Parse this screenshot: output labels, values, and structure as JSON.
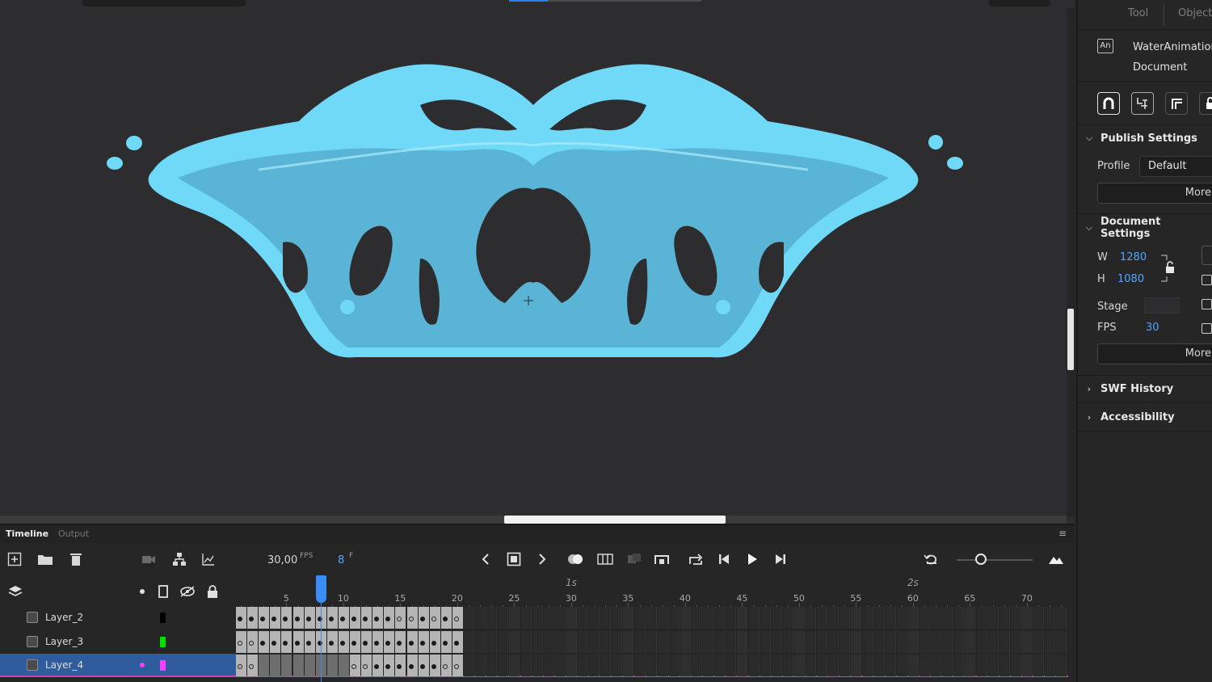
{
  "document": {
    "file_name": "WaterAnimation.f",
    "type_label": "Document"
  },
  "properties": {
    "tabs": [
      {
        "label": "Tool"
      },
      {
        "label": "Object"
      }
    ],
    "publish_settings": {
      "title": "Publish Settings",
      "profile_label": "Profile",
      "profile_value": "Default",
      "more_label": "More"
    },
    "document_settings": {
      "title": "Document Settings",
      "w_label": "W",
      "w_value": "1280",
      "h_label": "H",
      "h_value": "1080",
      "stage_label": "Stage",
      "fps_label": "FPS",
      "fps_value": "30",
      "more_label": "More"
    },
    "swf_history": {
      "title": "SWF History"
    },
    "accessibility": {
      "title": "Accessibility"
    }
  },
  "timeline": {
    "tabs": [
      {
        "label": "Timeline"
      },
      {
        "label": "Output"
      }
    ],
    "fps_value": "30,00",
    "fps_unit": "FPS",
    "frame_value": "8",
    "frame_unit": "F",
    "ruler_frames": [
      "5",
      "10",
      "15",
      "20",
      "25",
      "30",
      "35",
      "40",
      "45",
      "50",
      "55",
      "60",
      "65",
      "70"
    ],
    "ruler_seconds": [
      "1s",
      "2s"
    ],
    "current_frame": 8,
    "layers": [
      {
        "name": "Layer_2",
        "color": "#000000",
        "selected": false
      },
      {
        "name": "Layer_3",
        "color": "#00e000",
        "selected": false
      },
      {
        "name": "Layer_4",
        "color": "#ff3cff",
        "selected": true
      }
    ]
  },
  "colors": {
    "accent": "#3b8cf5",
    "water_light": "#6fd9f7",
    "water_dark": "#5ab4d6"
  }
}
